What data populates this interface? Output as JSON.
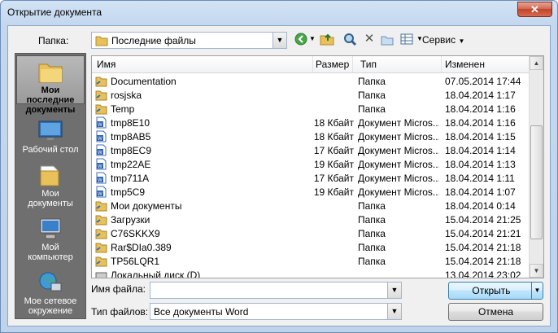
{
  "window": {
    "title": "Открытие документа",
    "close_glyph": "✕"
  },
  "folder": {
    "label": "Папка:",
    "value": "Последние файлы"
  },
  "toolbar": {
    "service_label": "Сервис"
  },
  "places": [
    {
      "label1": "Мои последние",
      "label2": "документы",
      "icon": "recent-docs-folder-icon"
    },
    {
      "label1": "Рабочий стол",
      "label2": "",
      "icon": "desktop-icon"
    },
    {
      "label1": "Мои",
      "label2": "документы",
      "icon": "my-documents-icon"
    },
    {
      "label1": "Мой",
      "label2": "компьютер",
      "icon": "my-computer-icon"
    },
    {
      "label1": "Мое сетевое",
      "label2": "окружение",
      "icon": "network-places-icon"
    }
  ],
  "list": {
    "columns": {
      "name": "Имя",
      "size": "Размер",
      "type": "Тип",
      "modified": "Изменен"
    },
    "rows": [
      {
        "name": "Documentation",
        "size": "",
        "type": "Папка",
        "modified": "07.05.2014 17:44",
        "kind": "folder"
      },
      {
        "name": "rosjska",
        "size": "",
        "type": "Папка",
        "modified": "18.04.2014 1:17",
        "kind": "folder"
      },
      {
        "name": "Temp",
        "size": "",
        "type": "Папка",
        "modified": "18.04.2014 1:16",
        "kind": "folder"
      },
      {
        "name": "tmp8E10",
        "size": "18 Кбайт",
        "type": "Документ Micros...",
        "modified": "18.04.2014 1:16",
        "kind": "doc"
      },
      {
        "name": "tmp8AB5",
        "size": "18 Кбайт",
        "type": "Документ Micros...",
        "modified": "18.04.2014 1:15",
        "kind": "doc"
      },
      {
        "name": "tmp8EC9",
        "size": "17 Кбайт",
        "type": "Документ Micros...",
        "modified": "18.04.2014 1:14",
        "kind": "doc"
      },
      {
        "name": "tmp22AE",
        "size": "19 Кбайт",
        "type": "Документ Micros...",
        "modified": "18.04.2014 1:13",
        "kind": "doc"
      },
      {
        "name": "tmp711A",
        "size": "17 Кбайт",
        "type": "Документ Micros...",
        "modified": "18.04.2014 1:11",
        "kind": "doc"
      },
      {
        "name": "tmp5C9",
        "size": "19 Кбайт",
        "type": "Документ Micros...",
        "modified": "18.04.2014 1:07",
        "kind": "doc"
      },
      {
        "name": "Мои документы",
        "size": "",
        "type": "Папка",
        "modified": "18.04.2014 0:14",
        "kind": "folder"
      },
      {
        "name": "Загрузки",
        "size": "",
        "type": "Папка",
        "modified": "15.04.2014 21:25",
        "kind": "folder"
      },
      {
        "name": "C76SKKX9",
        "size": "",
        "type": "Папка",
        "modified": "15.04.2014 21:21",
        "kind": "folder"
      },
      {
        "name": "Rar$DIa0.389",
        "size": "",
        "type": "Папка",
        "modified": "15.04.2014 21:18",
        "kind": "folder"
      },
      {
        "name": "TP56LQR1",
        "size": "",
        "type": "Папка",
        "modified": "15.04.2014 21:18",
        "kind": "folder"
      },
      {
        "name": "Локальный диск (D)",
        "size": "",
        "type": "",
        "modified": "13.04.2014 23:02",
        "kind": "drive"
      }
    ]
  },
  "filename": {
    "label": "Имя файла:",
    "value": ""
  },
  "filetype": {
    "label": "Тип файлов:",
    "value": "Все документы Word"
  },
  "buttons": {
    "open": "Открыть",
    "cancel": "Отмена"
  },
  "colors": {
    "accent": "#3c7fb1",
    "places_bg": "#6f6f6f",
    "folder": "#e8c15a"
  }
}
